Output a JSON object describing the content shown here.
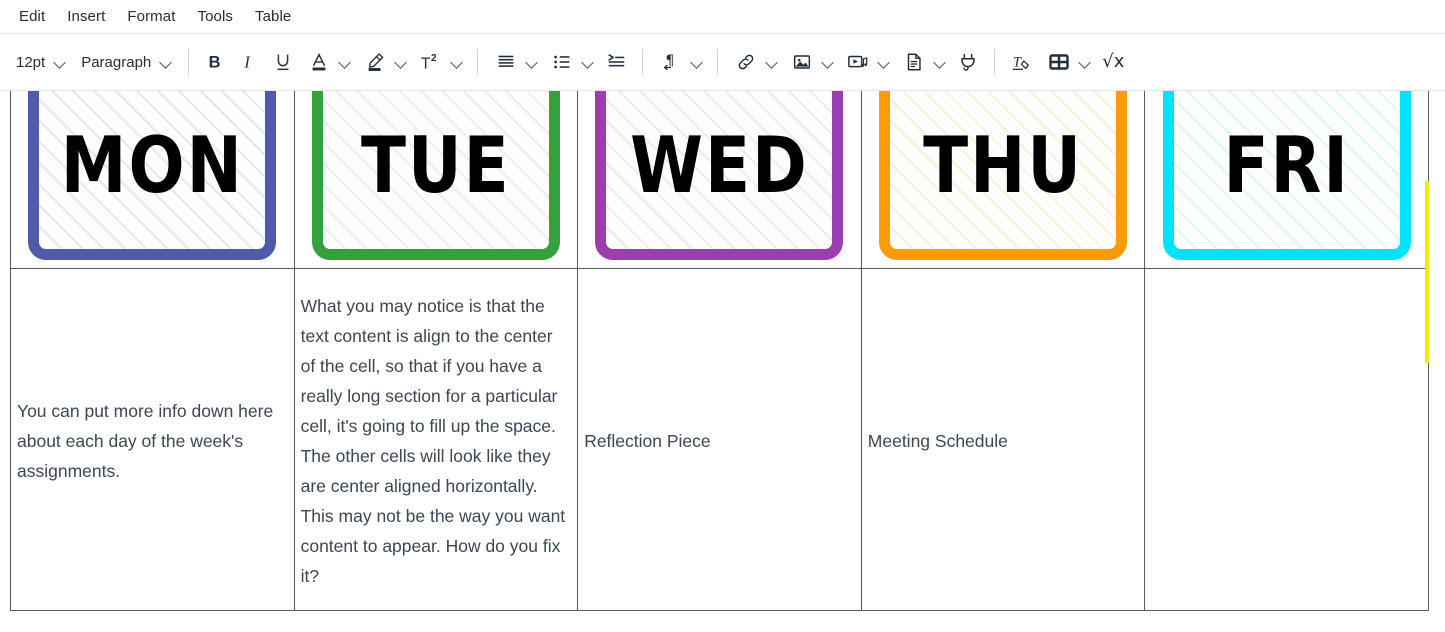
{
  "menubar": {
    "items": [
      {
        "label": "Edit",
        "name": "menu-edit"
      },
      {
        "label": "Insert",
        "name": "menu-insert"
      },
      {
        "label": "Format",
        "name": "menu-format"
      },
      {
        "label": "Tools",
        "name": "menu-tools"
      },
      {
        "label": "Table",
        "name": "menu-table"
      }
    ]
  },
  "toolbar": {
    "fontsize_value": "12pt",
    "blockformat_value": "Paragraph",
    "bold_label": "B",
    "italic_label": "I",
    "underline_label": "U",
    "textcolor_label": "A",
    "superscript_label": "T",
    "superscript_sup": "2",
    "sqrt_label": "√x",
    "items": [
      {
        "name": "font-size-select",
        "icon": "chevron-down-icon"
      },
      {
        "name": "block-format-select",
        "icon": "chevron-down-icon"
      },
      {
        "name": "bold-button",
        "icon": "bold-icon"
      },
      {
        "name": "italic-button",
        "icon": "italic-icon"
      },
      {
        "name": "underline-button",
        "icon": "underline-icon"
      },
      {
        "name": "text-color-button",
        "icon": "text-color-icon"
      },
      {
        "name": "highlight-color-button",
        "icon": "highlighter-icon"
      },
      {
        "name": "superscript-button",
        "icon": "superscript-icon"
      },
      {
        "name": "align-button",
        "icon": "align-justify-icon"
      },
      {
        "name": "bullet-list-button",
        "icon": "bullet-list-icon"
      },
      {
        "name": "indent-button",
        "icon": "indent-increase-icon"
      },
      {
        "name": "text-direction-button",
        "icon": "paragraph-rtl-icon"
      },
      {
        "name": "insert-link-button",
        "icon": "link-icon"
      },
      {
        "name": "insert-image-button",
        "icon": "image-icon"
      },
      {
        "name": "insert-media-button",
        "icon": "media-icon"
      },
      {
        "name": "insert-document-button",
        "icon": "document-icon"
      },
      {
        "name": "plugin-button",
        "icon": "plug-icon"
      },
      {
        "name": "clear-formatting-button",
        "icon": "clear-format-icon"
      },
      {
        "name": "table-button",
        "icon": "table-icon"
      },
      {
        "name": "equation-button",
        "icon": "square-root-icon"
      }
    ]
  },
  "document": {
    "table": {
      "header_cells": [
        {
          "day": "MON",
          "border_color": "#4f5aa8",
          "hatch_color": "rgba(120,128,180,0.18)"
        },
        {
          "day": "TUE",
          "border_color": "#33a13c",
          "hatch_color": "rgba(110,175,120,0.16)"
        },
        {
          "day": "WED",
          "border_color": "#9b3fae",
          "hatch_color": "rgba(165,115,180,0.16)"
        },
        {
          "day": "THU",
          "border_color": "#fb9c06",
          "hatch_color": "rgba(250,180,80,0.22)"
        },
        {
          "day": "FRI",
          "border_color": "#00e3fb",
          "hatch_color": "rgba(90,215,235,0.20)"
        }
      ],
      "body_cells": [
        {
          "text": "You can put more info down here about each day of the week's assignments."
        },
        {
          "text": "What you may notice is that the text content is align to the center of the cell, so that if you have a really long section for a particular cell, it's going to fill up the space. The other cells will look like they are center aligned horizontally. This may not be the way you want content to appear. How do you fix it?"
        },
        {
          "text": "Reflection Piece"
        },
        {
          "text": "Meeting Schedule"
        },
        {
          "text": ""
        }
      ]
    },
    "cut_off_card_color": "#ffe800"
  }
}
